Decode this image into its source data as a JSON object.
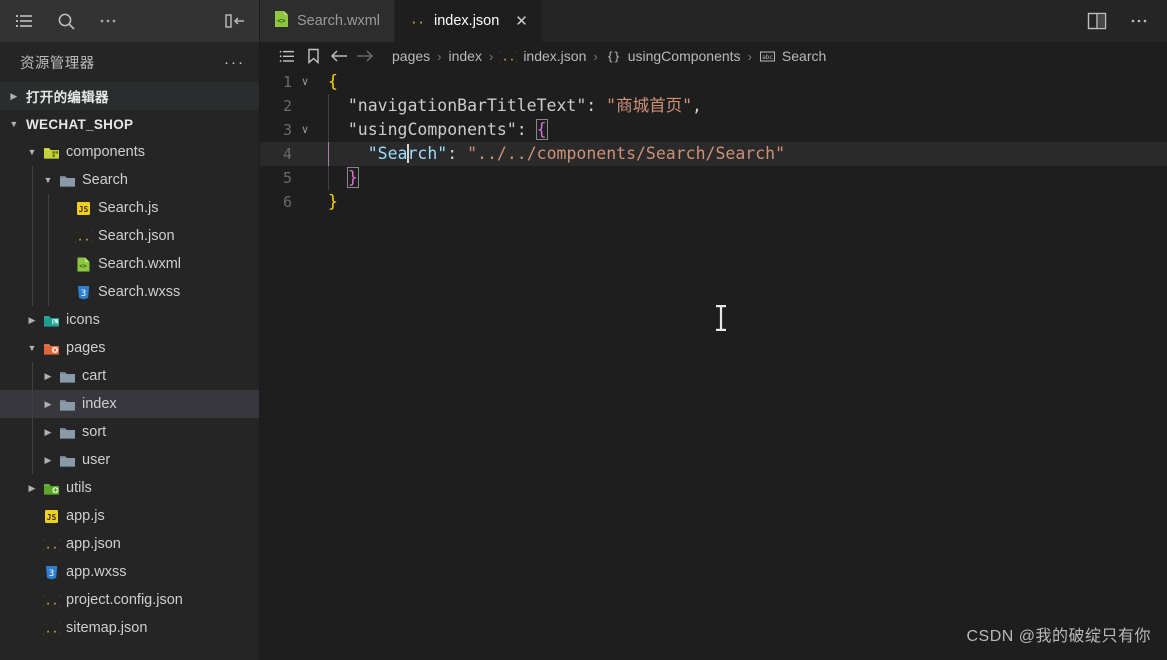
{
  "theme": {
    "bg_editor": "#1e1e1e",
    "bg_sidebar": "#252526",
    "bg_titlebar": "#333333",
    "accent_selected_row": "#37373d",
    "string_color": "#ce9178",
    "property_color": "#9cdcfe",
    "bracket_yellow": "#ffd700",
    "bracket_magenta": "#da70d6"
  },
  "activity_bar": {
    "icons": [
      {
        "name": "list-icon",
        "glyph": "list"
      },
      {
        "name": "search-icon",
        "glyph": "search"
      },
      {
        "name": "more-actions-icon",
        "glyph": "ellipsis"
      }
    ],
    "collapse_label": "collapse-sidebar-icon"
  },
  "sidebar": {
    "header_title": "资源管理器",
    "header_more": "···",
    "sections": [
      {
        "label": "打开的编辑器",
        "expanded": false,
        "highlighted": true
      },
      {
        "label": "WECHAT_SHOP",
        "expanded": true,
        "highlighted": false
      }
    ],
    "tree": [
      {
        "label": "components",
        "type": "folder",
        "icon": "folder-components",
        "depth": 1,
        "expanded": true,
        "selected": false
      },
      {
        "label": "Search",
        "type": "folder",
        "icon": "folder-plain",
        "depth": 2,
        "expanded": true,
        "selected": false
      },
      {
        "label": "Search.js",
        "type": "file",
        "icon": "js-icon",
        "depth": 3,
        "selected": false
      },
      {
        "label": "Search.json",
        "type": "file",
        "icon": "json-icon",
        "depth": 3,
        "selected": false
      },
      {
        "label": "Search.wxml",
        "type": "file",
        "icon": "wxml-icon",
        "depth": 3,
        "selected": false
      },
      {
        "label": "Search.wxss",
        "type": "file",
        "icon": "wxss-icon",
        "depth": 3,
        "selected": false
      },
      {
        "label": "icons",
        "type": "folder",
        "icon": "folder-images",
        "depth": 1,
        "expanded": false,
        "selected": false
      },
      {
        "label": "pages",
        "type": "folder",
        "icon": "folder-views",
        "depth": 1,
        "expanded": true,
        "selected": false
      },
      {
        "label": "cart",
        "type": "folder",
        "icon": "folder-plain",
        "depth": 2,
        "expanded": false,
        "selected": false
      },
      {
        "label": "index",
        "type": "folder",
        "icon": "folder-plain",
        "depth": 2,
        "expanded": false,
        "selected": true
      },
      {
        "label": "sort",
        "type": "folder",
        "icon": "folder-plain",
        "depth": 2,
        "expanded": false,
        "selected": false
      },
      {
        "label": "user",
        "type": "folder",
        "icon": "folder-plain",
        "depth": 2,
        "expanded": false,
        "selected": false
      },
      {
        "label": "utils",
        "type": "folder",
        "icon": "folder-utils",
        "depth": 1,
        "expanded": false,
        "selected": false
      },
      {
        "label": "app.js",
        "type": "file",
        "icon": "js-icon",
        "depth": 1,
        "selected": false
      },
      {
        "label": "app.json",
        "type": "file",
        "icon": "json-icon",
        "depth": 1,
        "selected": false
      },
      {
        "label": "app.wxss",
        "type": "file",
        "icon": "wxss-icon",
        "depth": 1,
        "selected": false
      },
      {
        "label": "project.config.json",
        "type": "file",
        "icon": "json-icon",
        "depth": 1,
        "selected": false
      },
      {
        "label": "sitemap.json",
        "type": "file",
        "icon": "json-icon",
        "depth": 1,
        "selected": false
      }
    ]
  },
  "tabs": [
    {
      "label": "Search.wxml",
      "icon": "wxml-icon",
      "active": false,
      "closable": false
    },
    {
      "label": "index.json",
      "icon": "json-icon",
      "active": true,
      "closable": true,
      "close_glyph": "✕"
    }
  ],
  "editor_actions": [
    {
      "name": "split-editor-icon"
    },
    {
      "name": "more-actions-icon",
      "glyph": "···"
    }
  ],
  "breadcrumbs": {
    "toolbar_icons": [
      "outline-icon",
      "bookmark-icon",
      "back-arrow-icon",
      "forward-arrow-icon"
    ],
    "segments": [
      {
        "label": "pages",
        "icon": "none"
      },
      {
        "label": "index",
        "icon": "none"
      },
      {
        "label": "index.json",
        "icon": "json-icon"
      },
      {
        "label": "usingComponents",
        "icon": "object-icon"
      },
      {
        "label": "Search",
        "icon": "string-icon"
      }
    ],
    "separator": "›"
  },
  "code": {
    "language": "json",
    "lines": [
      {
        "num": "1",
        "fold": "∨",
        "current": false
      },
      {
        "num": "2",
        "fold": "",
        "current": false
      },
      {
        "num": "3",
        "fold": "∨",
        "current": false
      },
      {
        "num": "4",
        "fold": "",
        "current": true
      },
      {
        "num": "5",
        "fold": "",
        "current": false
      },
      {
        "num": "6",
        "fold": "",
        "current": false
      }
    ],
    "text": {
      "l1_open_brace": "{",
      "l2_key": "\"navigationBarTitleText\"",
      "l2_colon": ":",
      "l2_value": "\"商城首页\"",
      "l2_comma": ",",
      "l3_key": "\"usingComponents\"",
      "l3_colon": ":",
      "l3_open_brace": "{",
      "l4_key_pre": "\"Sea",
      "l4_key_post": "rch\"",
      "l4_colon": ":",
      "l4_value": "\"../../components/Search/Search\"",
      "l5_close_brace": "}",
      "l6_close_brace": "}"
    }
  },
  "watermark": "CSDN @我的破绽只有你"
}
